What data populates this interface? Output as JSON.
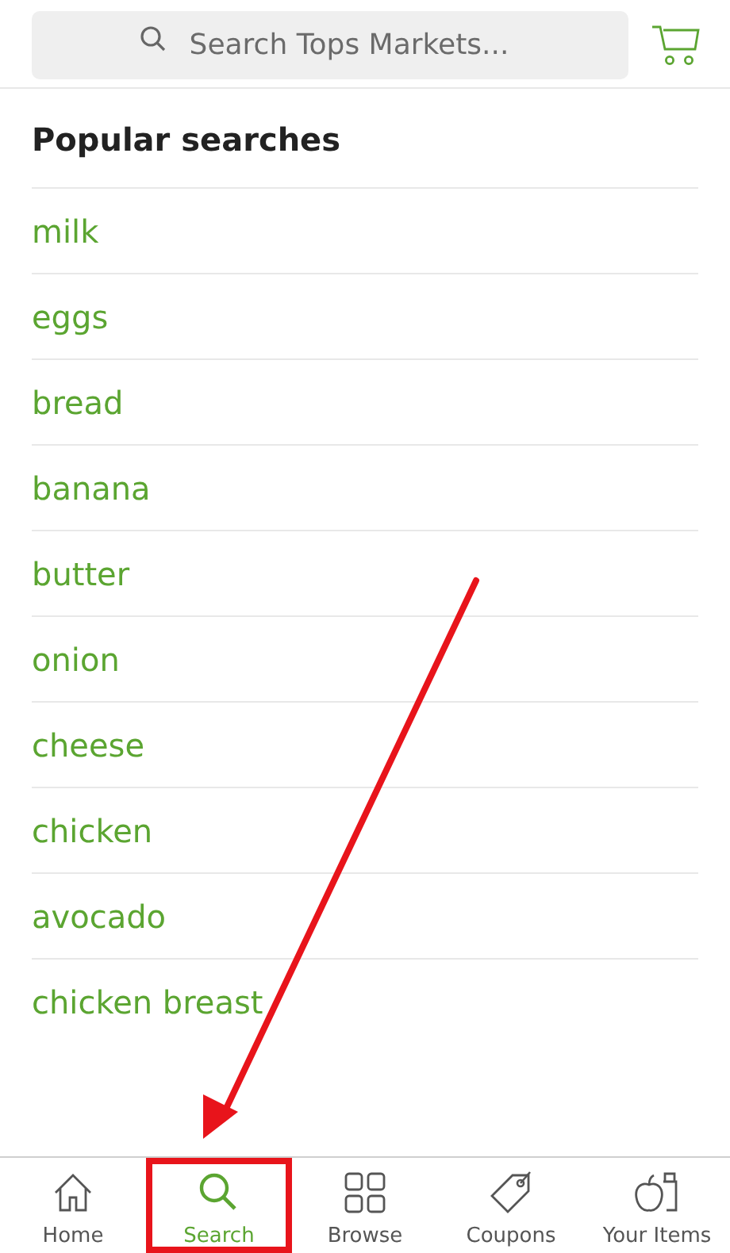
{
  "search": {
    "placeholder": "Search Tops Markets..."
  },
  "popular": {
    "title": "Popular searches",
    "items": [
      "milk",
      "eggs",
      "bread",
      "banana",
      "butter",
      "onion",
      "cheese",
      "chicken",
      "avocado",
      "chicken breast"
    ]
  },
  "tabs": [
    {
      "label": "Home",
      "selected": false,
      "highlighted": false
    },
    {
      "label": "Search",
      "selected": true,
      "highlighted": true
    },
    {
      "label": "Browse",
      "selected": false,
      "highlighted": false
    },
    {
      "label": "Coupons",
      "selected": false,
      "highlighted": false
    },
    {
      "label": "Your Items",
      "selected": false,
      "highlighted": false
    }
  ]
}
